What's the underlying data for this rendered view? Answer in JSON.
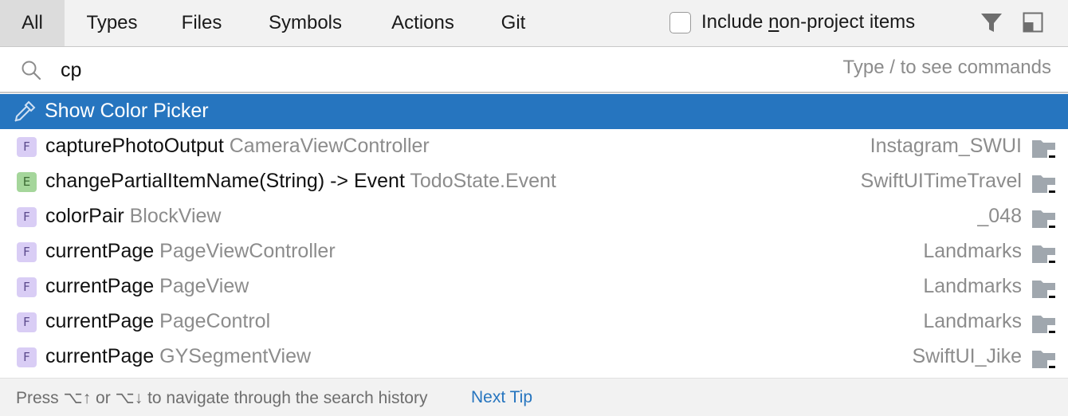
{
  "tabs": [
    {
      "label": "All",
      "active": true
    },
    {
      "label": "Types",
      "active": false
    },
    {
      "label": "Files",
      "active": false
    },
    {
      "label": "Symbols",
      "active": false
    },
    {
      "label": "Actions",
      "active": false
    },
    {
      "label": "Git",
      "active": false
    }
  ],
  "include_non_project": {
    "label_prefix": "Include ",
    "label_mnemonic": "n",
    "label_suffix": "on-project items",
    "checked": false
  },
  "toolbar_icons": [
    "filter-icon",
    "layout-icon"
  ],
  "search": {
    "icon": "search-icon",
    "value": "cp",
    "hint": "Type / to see commands"
  },
  "results": [
    {
      "kind": "action",
      "icon": "color-picker-icon",
      "name": "Show Color Picker",
      "context": "",
      "module": "",
      "selected": true
    },
    {
      "kind": "F",
      "name": "capturePhotoOutput",
      "context": "CameraViewController",
      "module": "Instagram_SWUI",
      "icon": "folder-icon"
    },
    {
      "kind": "E",
      "name": "changePartialItemName(String) -> Event",
      "context": "TodoState.Event",
      "module": "SwiftUITimeTravel",
      "icon": "folder-icon"
    },
    {
      "kind": "F",
      "name": "colorPair",
      "context": "BlockView",
      "module": "_048",
      "icon": "folder-icon"
    },
    {
      "kind": "F",
      "name": "currentPage",
      "context": "PageViewController",
      "module": "Landmarks",
      "icon": "folder-icon"
    },
    {
      "kind": "F",
      "name": "currentPage",
      "context": "PageView",
      "module": "Landmarks",
      "icon": "folder-icon"
    },
    {
      "kind": "F",
      "name": "currentPage",
      "context": "PageControl",
      "module": "Landmarks",
      "icon": "folder-icon"
    },
    {
      "kind": "F",
      "name": "currentPage",
      "context": "GYSegmentView",
      "module": "SwiftUI_Jike",
      "icon": "folder-icon"
    }
  ],
  "footer": {
    "text": "Press ⌥↑ or ⌥↓ to navigate through the search history",
    "link": "Next Tip"
  }
}
